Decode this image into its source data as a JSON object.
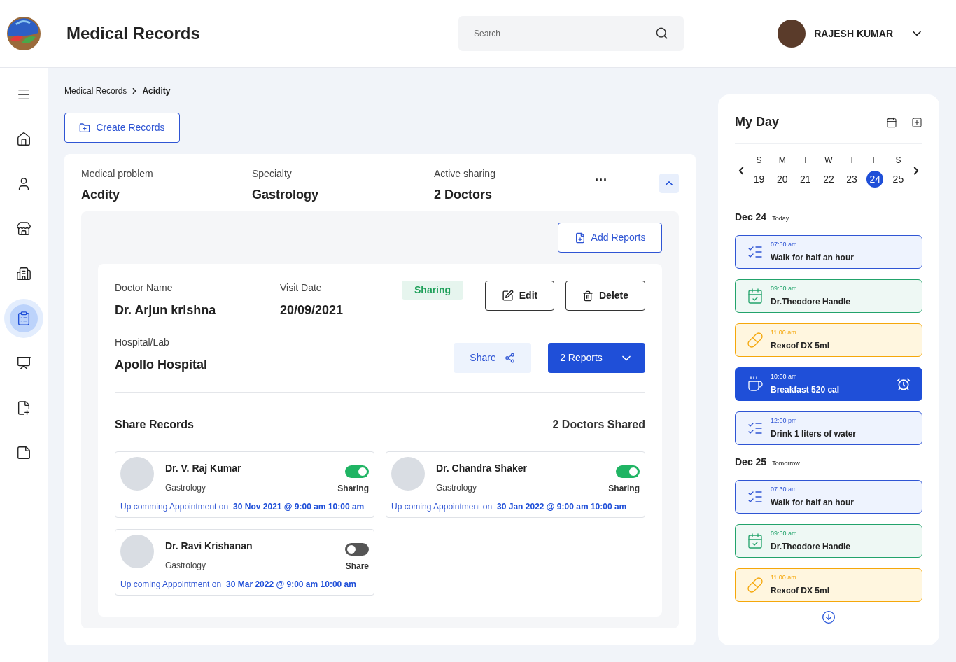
{
  "header": {
    "title": "Medical Records",
    "search": {
      "placeholder": "Search"
    },
    "user": {
      "name": "RAJESH KUMAR"
    }
  },
  "sidebar": {
    "items": [
      {
        "selected": false
      },
      {
        "selected": false
      },
      {
        "selected": false
      },
      {
        "selected": false
      },
      {
        "selected": false
      },
      {
        "selected": true
      },
      {
        "selected": false
      },
      {
        "selected": false
      },
      {
        "selected": false
      }
    ]
  },
  "breadcrumb": [
    "Medical Records",
    "Acidity"
  ],
  "create_button": "Create Records",
  "record": {
    "fields": [
      {
        "label": "Medical problem",
        "value": "Acdity"
      },
      {
        "label": "Specialty",
        "value": "Gastrology"
      },
      {
        "label": "Active sharing",
        "value": "2 Doctors"
      }
    ],
    "more": "···",
    "expanded": true,
    "add_reports": "Add Reports",
    "visit": {
      "doctor_label": "Doctor Name",
      "doctor": "Dr. Arjun krishna",
      "date_label": "Visit Date",
      "date": "20/09/2021",
      "status": "Sharing",
      "edit": "Edit",
      "delete": "Delete",
      "hospital_label": "Hospital/Lab",
      "hospital": "Apollo Hospital",
      "share": "Share",
      "reports": "2 Reports"
    },
    "share_title": "Share Records",
    "share_count": "2 Doctors Shared",
    "doctors": [
      {
        "name": "Dr. V. Raj Kumar",
        "specialty": "Gastrology",
        "on": true,
        "toggle_label": "Sharing",
        "appointment_label": "Up comming Appointment on",
        "appointment": "30 Nov 2021 @ 9:00 am 10:00 am"
      },
      {
        "name": "Dr. Chandra Shaker",
        "specialty": "Gastrology",
        "on": true,
        "toggle_label": "Sharing",
        "appointment_label": "Up coming Appointment on",
        "appointment": "30 Jan 2022 @ 9:00 am 10:00 am"
      },
      {
        "name": "Dr. Ravi Krishanan",
        "specialty": "Gastrology",
        "on": false,
        "toggle_label": "Share",
        "appointment_label": "Up coming Appointment on",
        "appointment": "30 Mar 2022 @ 9:00 am 10:00 am"
      }
    ]
  },
  "my_day": {
    "title": "My Day",
    "week": [
      {
        "day": "S",
        "date": "19",
        "selected": false
      },
      {
        "day": "M",
        "date": "20",
        "selected": false
      },
      {
        "day": "T",
        "date": "21",
        "selected": false
      },
      {
        "day": "W",
        "date": "22",
        "selected": false
      },
      {
        "day": "T",
        "date": "23",
        "selected": false
      },
      {
        "day": "F",
        "date": "24",
        "selected": true
      },
      {
        "day": "S",
        "date": "25",
        "selected": false
      }
    ],
    "days": [
      {
        "date": "Dec 24",
        "note": "Today",
        "events": [
          {
            "kind": "task",
            "time": "07:30 am",
            "title": "Walk for half an hour"
          },
          {
            "kind": "appointment",
            "time": "09:30 am",
            "title": "Dr.Theodore Handle"
          },
          {
            "kind": "medicine",
            "time": "11:00 am",
            "title": "Rexcof DX 5ml"
          },
          {
            "kind": "meal",
            "time": "10:00 am",
            "title": "Breakfast 520 cal"
          },
          {
            "kind": "task",
            "time": "12:00 pm",
            "title": "Drink 1 liters of water"
          }
        ]
      },
      {
        "date": "Dec 25",
        "note": "Tomorrow",
        "events": [
          {
            "kind": "task",
            "time": "07:30 am",
            "title": "Walk for half an hour"
          },
          {
            "kind": "appointment",
            "time": "09:30 am",
            "title": "Dr.Theodore Handle"
          },
          {
            "kind": "medicine",
            "time": "11:00 am",
            "title": "Rexcof DX 5ml"
          }
        ]
      }
    ]
  }
}
